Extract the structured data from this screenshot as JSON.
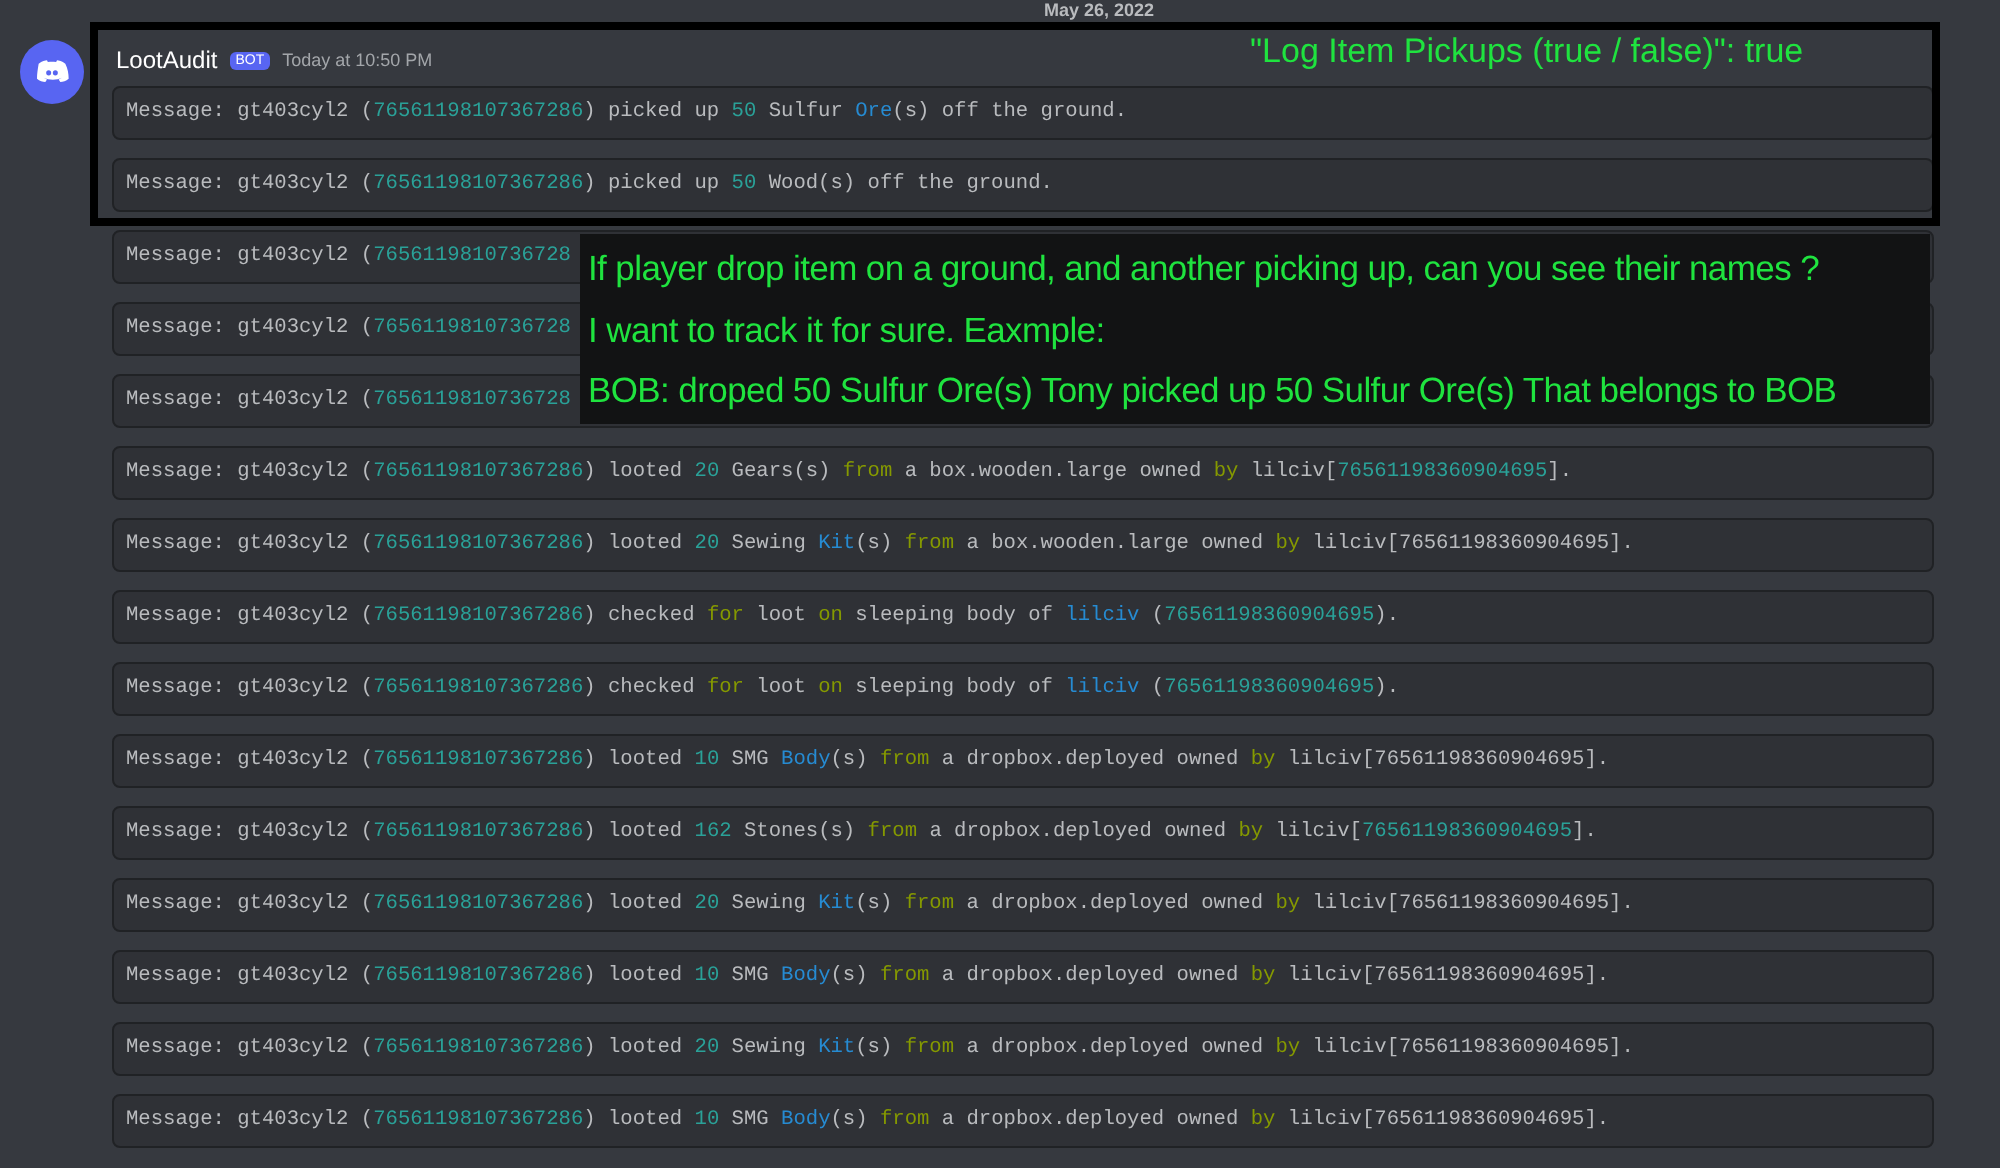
{
  "date_divider": "May 26, 2022",
  "message": {
    "author": "LootAudit",
    "badge": "BOT",
    "timestamp": "Today at 10:50 PM",
    "lines": [
      {
        "segments": [
          {
            "text": "Message: gt403cyl2 (",
            "kind": "plain"
          },
          {
            "text": "76561198107367286",
            "kind": "number"
          },
          {
            "text": ") picked up ",
            "kind": "plain"
          },
          {
            "text": "50",
            "kind": "number"
          },
          {
            "text": " Sulfur ",
            "kind": "plain"
          },
          {
            "text": "Ore",
            "kind": "type"
          },
          {
            "text": "(s) off the ground.",
            "kind": "plain"
          }
        ]
      },
      {
        "segments": [
          {
            "text": "Message: gt403cyl2 (",
            "kind": "plain"
          },
          {
            "text": "76561198107367286",
            "kind": "number"
          },
          {
            "text": ") picked up ",
            "kind": "plain"
          },
          {
            "text": "50",
            "kind": "number"
          },
          {
            "text": " Wood(s) off the ground.",
            "kind": "plain"
          }
        ]
      },
      {
        "segments": [
          {
            "text": "Message: gt403cyl2 (",
            "kind": "plain"
          },
          {
            "text": "7656119810736728",
            "kind": "number"
          }
        ]
      },
      {
        "segments": [
          {
            "text": "Message: gt403cyl2 (",
            "kind": "plain"
          },
          {
            "text": "7656119810736728",
            "kind": "number"
          }
        ]
      },
      {
        "segments": [
          {
            "text": "Message: gt403cyl2 (",
            "kind": "plain"
          },
          {
            "text": "7656119810736728",
            "kind": "number"
          }
        ]
      },
      {
        "segments": [
          {
            "text": "Message: gt403cyl2 (",
            "kind": "plain"
          },
          {
            "text": "76561198107367286",
            "kind": "number"
          },
          {
            "text": ") looted ",
            "kind": "plain"
          },
          {
            "text": "20",
            "kind": "number"
          },
          {
            "text": " Gears(s) ",
            "kind": "plain"
          },
          {
            "text": "from",
            "kind": "keyword"
          },
          {
            "text": " a box.wooden.large owned ",
            "kind": "plain"
          },
          {
            "text": "by",
            "kind": "keyword"
          },
          {
            "text": " lilciv[",
            "kind": "plain"
          },
          {
            "text": "76561198360904695",
            "kind": "number"
          },
          {
            "text": "].",
            "kind": "plain"
          }
        ]
      },
      {
        "segments": [
          {
            "text": "Message: gt403cyl2 (",
            "kind": "plain"
          },
          {
            "text": "76561198107367286",
            "kind": "number"
          },
          {
            "text": ") looted ",
            "kind": "plain"
          },
          {
            "text": "20",
            "kind": "number"
          },
          {
            "text": " Sewing ",
            "kind": "plain"
          },
          {
            "text": "Kit",
            "kind": "type"
          },
          {
            "text": "(s) ",
            "kind": "plain"
          },
          {
            "text": "from",
            "kind": "keyword"
          },
          {
            "text": " a box.wooden.large owned ",
            "kind": "plain"
          },
          {
            "text": "by",
            "kind": "keyword"
          },
          {
            "text": " lilciv[76561198360904695].",
            "kind": "plain"
          }
        ]
      },
      {
        "segments": [
          {
            "text": "Message: gt403cyl2 (",
            "kind": "plain"
          },
          {
            "text": "76561198107367286",
            "kind": "number"
          },
          {
            "text": ") checked ",
            "kind": "plain"
          },
          {
            "text": "for",
            "kind": "keyword"
          },
          {
            "text": " loot ",
            "kind": "plain"
          },
          {
            "text": "on",
            "kind": "keyword"
          },
          {
            "text": " sleeping body of ",
            "kind": "plain"
          },
          {
            "text": "lilciv",
            "kind": "type"
          },
          {
            "text": " (",
            "kind": "plain"
          },
          {
            "text": "76561198360904695",
            "kind": "number"
          },
          {
            "text": ").",
            "kind": "plain"
          }
        ]
      },
      {
        "segments": [
          {
            "text": "Message: gt403cyl2 (",
            "kind": "plain"
          },
          {
            "text": "76561198107367286",
            "kind": "number"
          },
          {
            "text": ") checked ",
            "kind": "plain"
          },
          {
            "text": "for",
            "kind": "keyword"
          },
          {
            "text": " loot ",
            "kind": "plain"
          },
          {
            "text": "on",
            "kind": "keyword"
          },
          {
            "text": " sleeping body of ",
            "kind": "plain"
          },
          {
            "text": "lilciv",
            "kind": "type"
          },
          {
            "text": " (",
            "kind": "plain"
          },
          {
            "text": "76561198360904695",
            "kind": "number"
          },
          {
            "text": ").",
            "kind": "plain"
          }
        ]
      },
      {
        "segments": [
          {
            "text": "Message: gt403cyl2 (",
            "kind": "plain"
          },
          {
            "text": "76561198107367286",
            "kind": "number"
          },
          {
            "text": ") looted ",
            "kind": "plain"
          },
          {
            "text": "10",
            "kind": "number"
          },
          {
            "text": " SMG ",
            "kind": "plain"
          },
          {
            "text": "Body",
            "kind": "type"
          },
          {
            "text": "(s) ",
            "kind": "plain"
          },
          {
            "text": "from",
            "kind": "keyword"
          },
          {
            "text": " a dropbox.deployed owned ",
            "kind": "plain"
          },
          {
            "text": "by",
            "kind": "keyword"
          },
          {
            "text": " lilciv[76561198360904695].",
            "kind": "plain"
          }
        ]
      },
      {
        "segments": [
          {
            "text": "Message: gt403cyl2 (",
            "kind": "plain"
          },
          {
            "text": "76561198107367286",
            "kind": "number"
          },
          {
            "text": ") looted ",
            "kind": "plain"
          },
          {
            "text": "162",
            "kind": "number"
          },
          {
            "text": " Stones(s) ",
            "kind": "plain"
          },
          {
            "text": "from",
            "kind": "keyword"
          },
          {
            "text": " a dropbox.deployed owned ",
            "kind": "plain"
          },
          {
            "text": "by",
            "kind": "keyword"
          },
          {
            "text": " lilciv[",
            "kind": "plain"
          },
          {
            "text": "76561198360904695",
            "kind": "number"
          },
          {
            "text": "].",
            "kind": "plain"
          }
        ]
      },
      {
        "segments": [
          {
            "text": "Message: gt403cyl2 (",
            "kind": "plain"
          },
          {
            "text": "76561198107367286",
            "kind": "number"
          },
          {
            "text": ") looted ",
            "kind": "plain"
          },
          {
            "text": "20",
            "kind": "number"
          },
          {
            "text": " Sewing ",
            "kind": "plain"
          },
          {
            "text": "Kit",
            "kind": "type"
          },
          {
            "text": "(s) ",
            "kind": "plain"
          },
          {
            "text": "from",
            "kind": "keyword"
          },
          {
            "text": " a dropbox.deployed owned ",
            "kind": "plain"
          },
          {
            "text": "by",
            "kind": "keyword"
          },
          {
            "text": " lilciv[76561198360904695].",
            "kind": "plain"
          }
        ]
      },
      {
        "segments": [
          {
            "text": "Message: gt403cyl2 (",
            "kind": "plain"
          },
          {
            "text": "76561198107367286",
            "kind": "number"
          },
          {
            "text": ") looted ",
            "kind": "plain"
          },
          {
            "text": "10",
            "kind": "number"
          },
          {
            "text": " SMG ",
            "kind": "plain"
          },
          {
            "text": "Body",
            "kind": "type"
          },
          {
            "text": "(s) ",
            "kind": "plain"
          },
          {
            "text": "from",
            "kind": "keyword"
          },
          {
            "text": " a dropbox.deployed owned ",
            "kind": "plain"
          },
          {
            "text": "by",
            "kind": "keyword"
          },
          {
            "text": " lilciv[76561198360904695].",
            "kind": "plain"
          }
        ]
      },
      {
        "segments": [
          {
            "text": "Message: gt403cyl2 (",
            "kind": "plain"
          },
          {
            "text": "76561198107367286",
            "kind": "number"
          },
          {
            "text": ") looted ",
            "kind": "plain"
          },
          {
            "text": "20",
            "kind": "number"
          },
          {
            "text": " Sewing ",
            "kind": "plain"
          },
          {
            "text": "Kit",
            "kind": "type"
          },
          {
            "text": "(s) ",
            "kind": "plain"
          },
          {
            "text": "from",
            "kind": "keyword"
          },
          {
            "text": " a dropbox.deployed owned ",
            "kind": "plain"
          },
          {
            "text": "by",
            "kind": "keyword"
          },
          {
            "text": " lilciv[76561198360904695].",
            "kind": "plain"
          }
        ]
      },
      {
        "segments": [
          {
            "text": "Message: gt403cyl2 (",
            "kind": "plain"
          },
          {
            "text": "76561198107367286",
            "kind": "number"
          },
          {
            "text": ") looted ",
            "kind": "plain"
          },
          {
            "text": "10",
            "kind": "number"
          },
          {
            "text": " SMG ",
            "kind": "plain"
          },
          {
            "text": "Body",
            "kind": "type"
          },
          {
            "text": "(s) ",
            "kind": "plain"
          },
          {
            "text": "from",
            "kind": "keyword"
          },
          {
            "text": " a dropbox.deployed owned ",
            "kind": "plain"
          },
          {
            "text": "by",
            "kind": "keyword"
          },
          {
            "text": " lilciv[76561198360904695].",
            "kind": "plain"
          }
        ]
      }
    ]
  },
  "annotations": {
    "highlight_label": "\"Log Item Pickups (true / false)\": true",
    "note_lines": [
      "If player drop item on a ground, and another picking up, can you see their names ?",
      "I want to track it for sure. Eaxmple:",
      "BOB: droped 50 Sulfur Ore(s) Tony picked up 50 Sulfur Ore(s) That belongs to BOB"
    ]
  }
}
